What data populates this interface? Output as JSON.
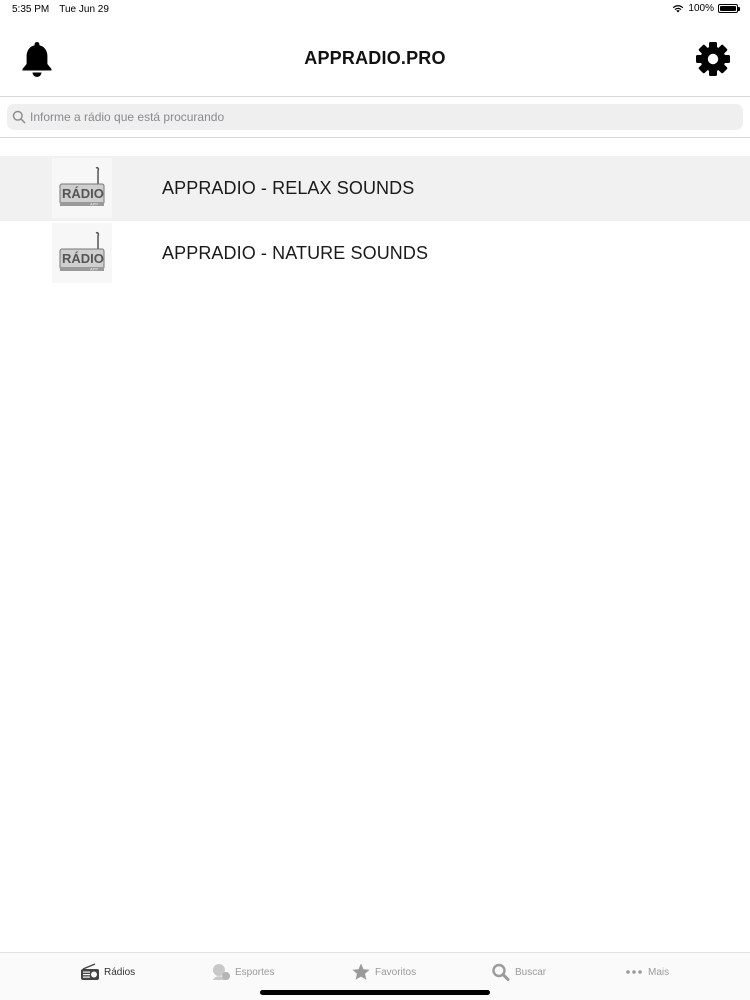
{
  "status_bar": {
    "time": "5:35 PM",
    "date": "Tue Jun 29",
    "battery": "100%"
  },
  "nav": {
    "title": "APPRADIO.PRO"
  },
  "search": {
    "placeholder": "Informe a rádio que está procurando"
  },
  "stations": [
    {
      "name": "APPRADIO - RELAX SOUNDS",
      "logo_text": "RÁDIO"
    },
    {
      "name": "APPRADIO - NATURE SOUNDS",
      "logo_text": "RÁDIO"
    }
  ],
  "tabs": [
    {
      "label": "Rádios",
      "icon": "radio-icon",
      "active": true
    },
    {
      "label": "Esportes",
      "icon": "sports-icon",
      "active": false
    },
    {
      "label": "Favoritos",
      "icon": "star-icon",
      "active": false
    },
    {
      "label": "Buscar",
      "icon": "search-icon",
      "active": false
    },
    {
      "label": "Mais",
      "icon": "more-icon",
      "active": false
    }
  ],
  "colors": {
    "selected_row": "#f1f1f2",
    "tab_active": "#333333",
    "tab_inactive": "#9a9a9a"
  }
}
